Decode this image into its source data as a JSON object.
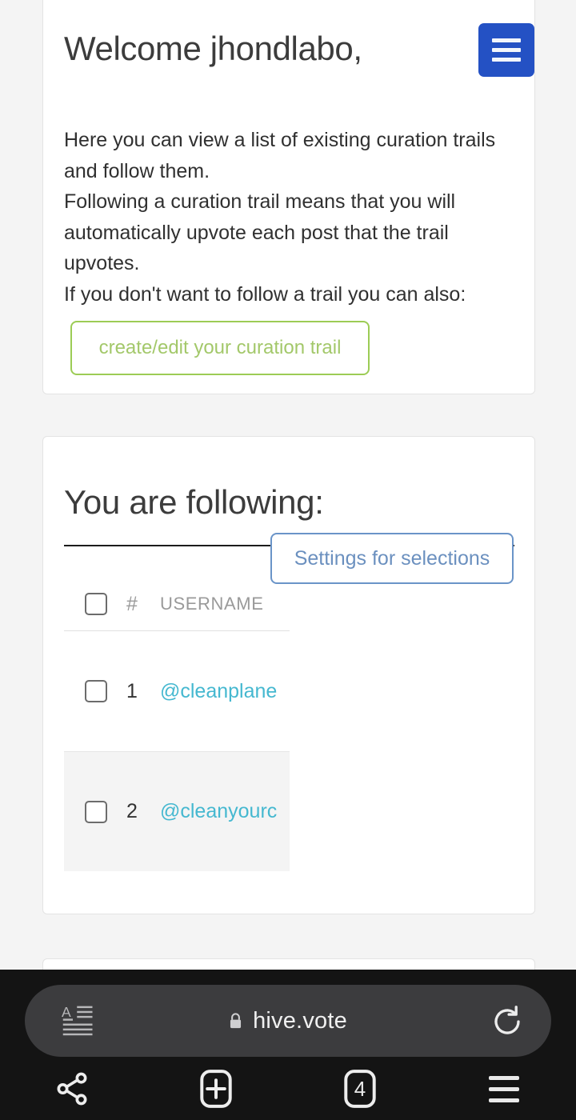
{
  "page": {
    "background_color": "#f4f4f4",
    "card_background": "#ffffff"
  },
  "welcome_card": {
    "heading": "Welcome jhondlabo,",
    "menu_toggle": {
      "icon": "hamburger-icon",
      "color": "#2451c4"
    },
    "paragraph": "Here you can view a list of existing curation trails and follow them.\nFollowing a curation trail means that you will automatically upvote each post that the trail upvotes.\nIf you don't want to follow a trail you can also:",
    "create_trail_button": {
      "label": "create/edit your curation trail",
      "border_color": "#9ccc55",
      "text_color": "#a3c86a"
    }
  },
  "following_card": {
    "heading": "You are following:",
    "settings_button": {
      "label": "Settings for selections",
      "border_color": "#6a94c8",
      "text_color": "#6b90bf"
    },
    "table": {
      "columns": [
        "",
        "#",
        "USERNAME"
      ],
      "rows": [
        {
          "num": "1",
          "username": "@cleanplane"
        },
        {
          "num": "2",
          "username": "@cleanyourc"
        }
      ],
      "link_color": "#45b8d0"
    }
  },
  "browser": {
    "url": "hive.vote",
    "secure_icon": "lock-icon",
    "reader_mode_icon": "reader-mode-icon",
    "reload_icon": "reload-icon",
    "nav": [
      {
        "icon": "share-icon",
        "label": ""
      },
      {
        "icon": "new-tab-icon",
        "label": ""
      },
      {
        "icon": "tab-count-icon",
        "label": "4"
      },
      {
        "icon": "menu-icon",
        "label": ""
      }
    ]
  }
}
